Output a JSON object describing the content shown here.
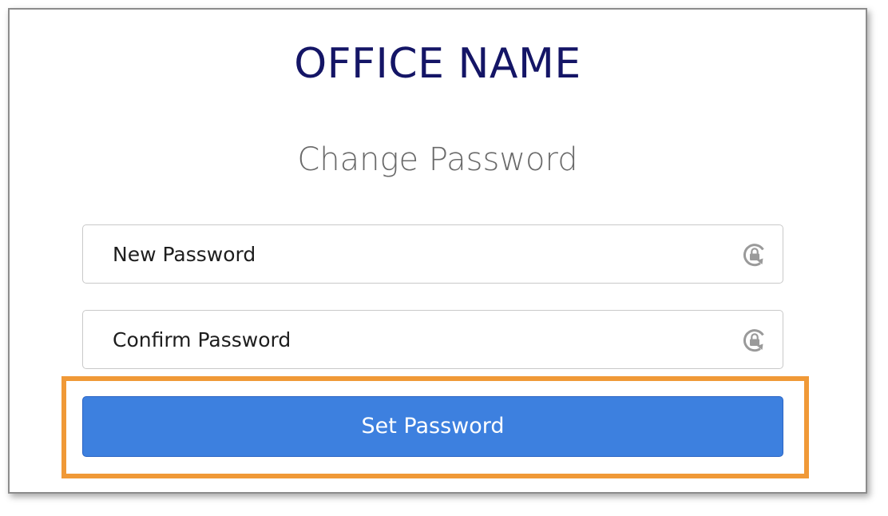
{
  "header": {
    "office_name": "OFFICE NAME",
    "subtitle": "Change Password"
  },
  "form": {
    "new_password": {
      "placeholder": "New Password",
      "value": "",
      "icon": "lock-reset-icon"
    },
    "confirm_password": {
      "placeholder": "Confirm Password",
      "value": "",
      "icon": "lock-reset-icon"
    },
    "submit_label": "Set Password"
  },
  "colors": {
    "title": "#141566",
    "button": "#3d80df",
    "highlight": "#f09937"
  }
}
